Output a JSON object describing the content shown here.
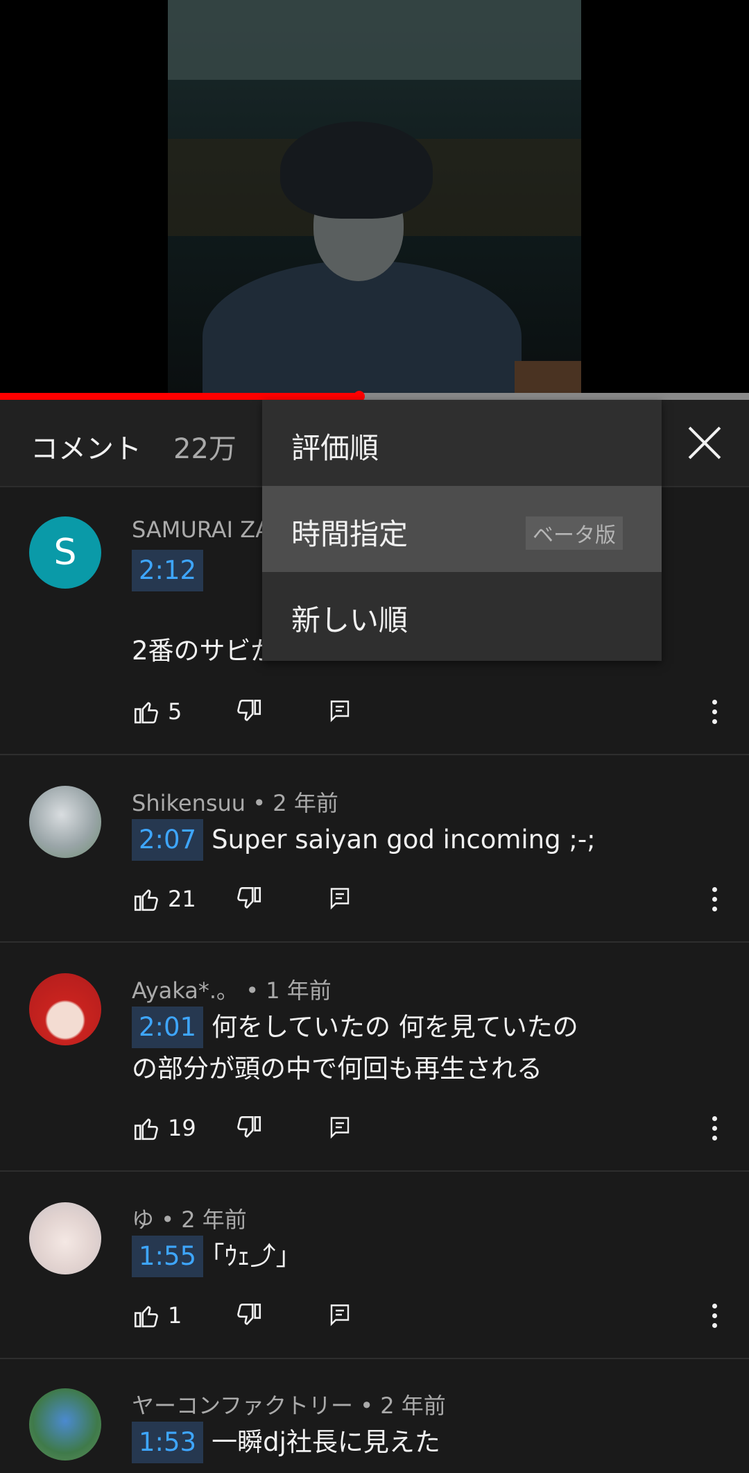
{
  "header": {
    "title": "コメント",
    "count": "22万"
  },
  "sort_menu": {
    "items": [
      {
        "label": "評価順"
      },
      {
        "label": "時間指定",
        "badge": "ベータ版"
      },
      {
        "label": "新しい順"
      }
    ],
    "selected": "時間指定"
  },
  "progress": {
    "played_fraction": 0.48
  },
  "comments": [
    {
      "author": "SAMURAI ZA",
      "age": "",
      "timestamp": "2:12",
      "text": "",
      "text2": "2番のサビが",
      "likes": "5",
      "avatar_letter": "S"
    },
    {
      "author": "Shikensuu",
      "age": "2 年前",
      "timestamp": "2:07",
      "text": "Super saiyan god incoming ;-;",
      "likes": "21"
    },
    {
      "author": "Ayaka*.。",
      "age": "1 年前",
      "timestamp": "2:01",
      "text": "何をしていたの 何を見ていたの",
      "text2": "の部分が頭の中で何回も再生される",
      "likes": "19"
    },
    {
      "author": "ゆ",
      "age": "2 年前",
      "timestamp": "1:55",
      "text": "｢ｳｪ⤴｣",
      "likes": "1"
    },
    {
      "author": "ヤーコンファクトリー",
      "age": "2 年前",
      "timestamp": "1:53",
      "text": "一瞬dj社長に見えた"
    }
  ],
  "separator": "•",
  "colors": {
    "accent": "#3ea6ff",
    "timestamp_bg": "#263850",
    "progress": "#ff0000"
  }
}
